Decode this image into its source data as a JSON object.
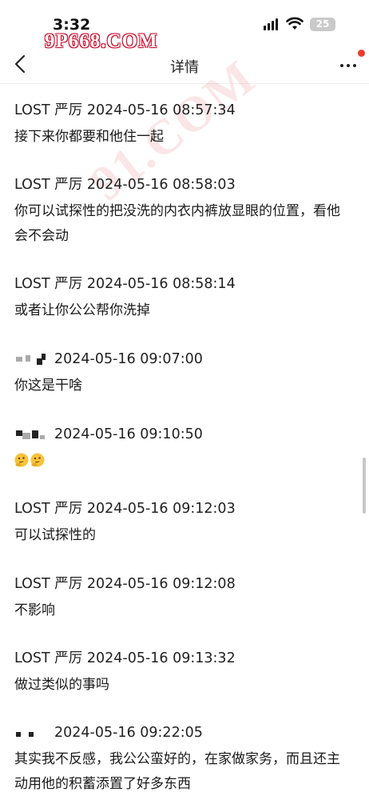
{
  "status_bar": {
    "time": "3:32",
    "battery": "25"
  },
  "watermark": {
    "top": "9P668.COM",
    "diagonal": "91.COM"
  },
  "nav": {
    "title": "详情"
  },
  "messages": [
    {
      "sender": "LOST 严厉",
      "timestamp": "2024-05-16 08:57:34",
      "text": "接下来你都要和他住一起"
    },
    {
      "sender": "LOST 严厉",
      "timestamp": "2024-05-16 08:58:03",
      "text": "你可以试探性的把没洗的内衣内裤放显眼的位置，看他会不会动"
    },
    {
      "sender": "LOST 严厉",
      "timestamp": "2024-05-16 08:58:14",
      "text": "或者让你公公帮你洗掉"
    },
    {
      "sender": "",
      "timestamp": "2024-05-16 09:07:00",
      "text": "你这是干啥"
    },
    {
      "sender": "",
      "timestamp": "2024-05-16 09:10:50",
      "text": ""
    },
    {
      "sender": "LOST 严厉",
      "timestamp": "2024-05-16 09:12:03",
      "text": "可以试探性的"
    },
    {
      "sender": "LOST 严厉",
      "timestamp": "2024-05-16 09:12:08",
      "text": "不影响"
    },
    {
      "sender": "LOST 严厉",
      "timestamp": "2024-05-16 09:13:32",
      "text": "做过类似的事吗"
    },
    {
      "sender": "",
      "timestamp": "2024-05-16 09:22:05",
      "text": "其实我不反感，我公公蛮好的，在家做家务，而且还主动用他的积蓄添置了好多东西"
    }
  ]
}
